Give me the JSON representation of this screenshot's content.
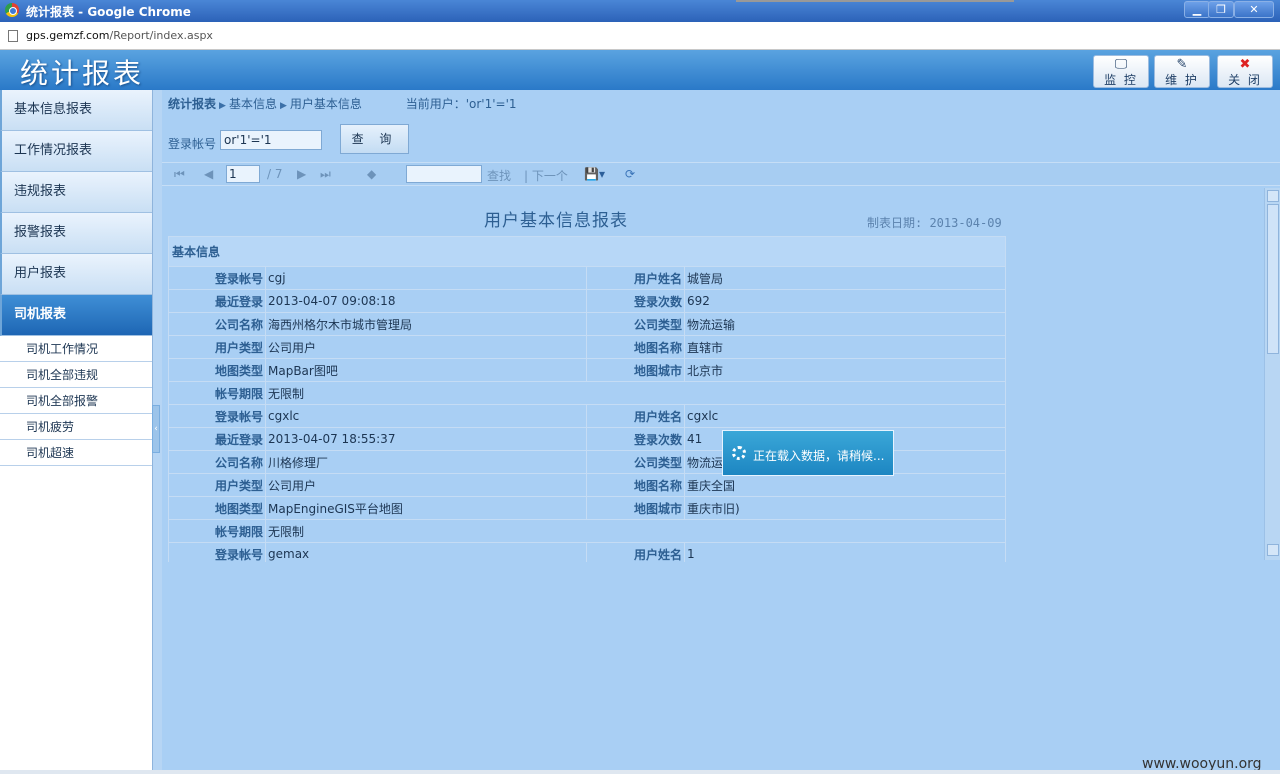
{
  "window": {
    "title": "统计报表  - Google Chrome",
    "url_domain": "gps.gemzf.com",
    "url_path": "/Report/index.aspx"
  },
  "header": {
    "app_title": "统计报表",
    "buttons": [
      {
        "label": "监 控",
        "icon": "monitor-icon"
      },
      {
        "label": "维 护",
        "icon": "wrench-icon"
      },
      {
        "label": "关 闭",
        "icon": "close-icon"
      }
    ]
  },
  "sidebar": {
    "items": [
      {
        "label": "基本信息报表"
      },
      {
        "label": "工作情况报表"
      },
      {
        "label": "违规报表"
      },
      {
        "label": "报警报表"
      },
      {
        "label": "用户报表"
      },
      {
        "label": "司机报表",
        "active": true
      }
    ],
    "sub_items": [
      {
        "label": "司机工作情况"
      },
      {
        "label": "司机全部违规"
      },
      {
        "label": "司机全部报警"
      },
      {
        "label": "司机疲劳"
      },
      {
        "label": "司机超速"
      }
    ]
  },
  "breadcrumb": {
    "root": "统计报表",
    "level1": "基本信息",
    "level2": "用户基本信息",
    "current_user": "当前用户：'or'1'='1"
  },
  "query": {
    "label": "登录帐号",
    "value": "or'1'='1",
    "button": "查 询"
  },
  "toolbar": {
    "page_value": "1",
    "total": "/ 7",
    "find": "查找",
    "find_next": "| 下一个"
  },
  "report": {
    "title": "用户基本信息报表",
    "date": "制表日期: 2013-04-09",
    "section": "基本信息",
    "records": [
      [
        {
          "k1": "登录帐号",
          "v1": "cgj",
          "k2": "用户姓名",
          "v2": "城管局"
        },
        {
          "k1": "最近登录",
          "v1": "2013-04-07 09:08:18",
          "k2": "登录次数",
          "v2": "692"
        },
        {
          "k1": "公司名称",
          "v1": "海西州格尔木市城市管理局",
          "k2": "公司类型",
          "v2": "物流运输"
        },
        {
          "k1": "用户类型",
          "v1": "公司用户",
          "k2": "地图名称",
          "v2": "直辖市"
        },
        {
          "k1": "地图类型",
          "v1": "MapBar图吧",
          "k2": "地图城市",
          "v2": "北京市"
        },
        {
          "k1": "帐号期限",
          "v1": "无限制",
          "k2": "",
          "v2": ""
        }
      ],
      [
        {
          "k1": "登录帐号",
          "v1": "cgxlc",
          "k2": "用户姓名",
          "v2": "cgxlc"
        },
        {
          "k1": "最近登录",
          "v1": "2013-04-07 18:55:37",
          "k2": "登录次数",
          "v2": "41"
        },
        {
          "k1": "公司名称",
          "v1": "川格修理厂",
          "k2": "公司类型",
          "v2": "物流运"
        },
        {
          "k1": "用户类型",
          "v1": "公司用户",
          "k2": "地图名称",
          "v2": "重庆全国"
        },
        {
          "k1": "地图类型",
          "v1": "MapEngineGIS平台地图",
          "k2": "地图城市",
          "v2": "重庆市旧)"
        },
        {
          "k1": "帐号期限",
          "v1": "无限制",
          "k2": "",
          "v2": ""
        }
      ],
      [
        {
          "k1": "登录帐号",
          "v1": "gemax",
          "k2": "用户姓名",
          "v2": "1"
        }
      ]
    ]
  },
  "loading": {
    "message": "正在载入数据，请稍候..."
  },
  "watermark": "www.wooyun.org"
}
